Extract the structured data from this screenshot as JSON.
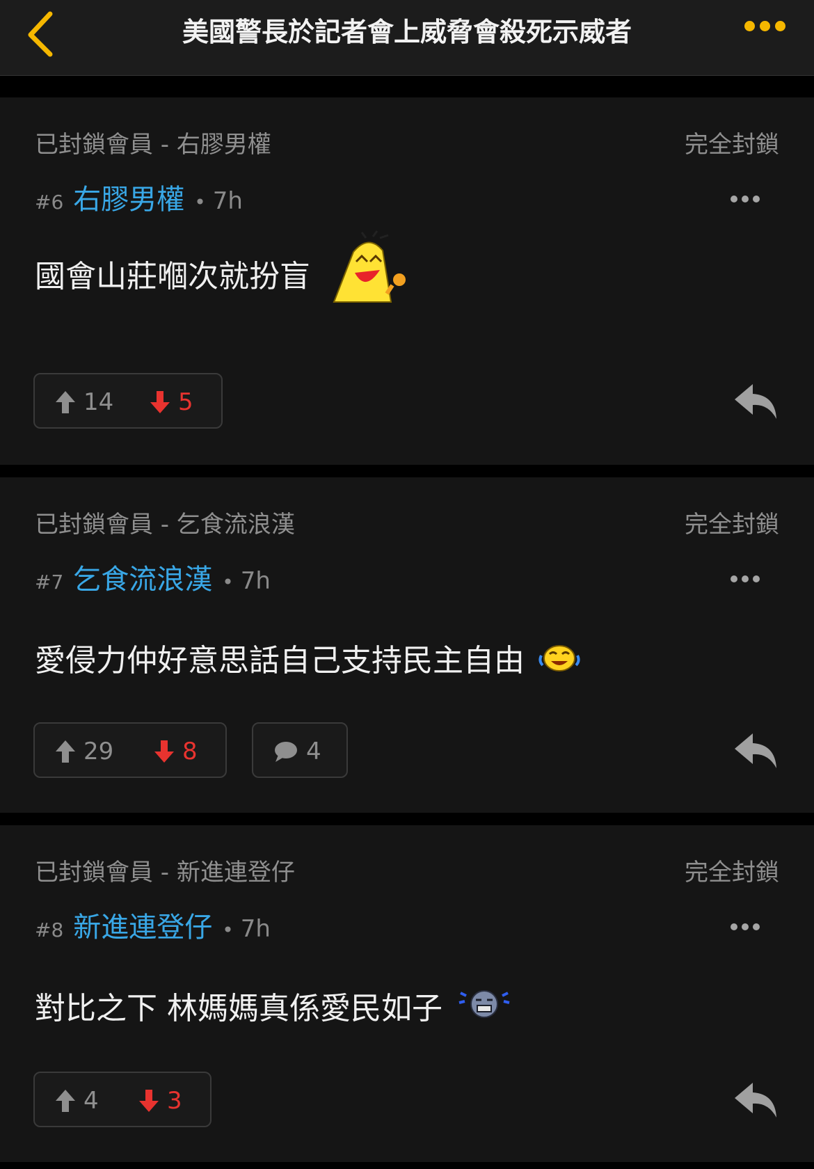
{
  "header": {
    "title": "美國警長於記者會上威脅會殺死示威者",
    "back_icon": "chevron-left-icon",
    "more_icon": "more-horizontal-icon",
    "accent_color": "#f5b700"
  },
  "posts": [
    {
      "blocked_label": "已封鎖會員 - 右膠男權",
      "block_all": "完全封鎖",
      "floor": "#6",
      "author": "右膠男權",
      "time": "7h",
      "content": "國會山莊嗰次就扮盲",
      "emoji": "laughing-chick-emoji",
      "upvotes": "14",
      "downvotes": "5"
    },
    {
      "blocked_label": "已封鎖會員 - 乞食流浪漢",
      "block_all": "完全封鎖",
      "floor": "#7",
      "author": "乞食流浪漢",
      "time": "7h",
      "content": "愛侵力仲好意思話自己支持民主自由",
      "emoji": "crying-laugh-emoji",
      "upvotes": "29",
      "downvotes": "8",
      "comments": "4"
    },
    {
      "blocked_label": "已封鎖會員 - 新進連登仔",
      "block_all": "完全封鎖",
      "floor": "#8",
      "author": "新進連登仔",
      "time": "7h",
      "content": "對比之下 林媽媽真係愛民如子",
      "emoji": "sad-crying-emoji",
      "upvotes": "4",
      "downvotes": "3"
    }
  ],
  "colors": {
    "author": "#39a7e6",
    "downvote": "#e8332f",
    "muted": "#8f8f8f"
  }
}
